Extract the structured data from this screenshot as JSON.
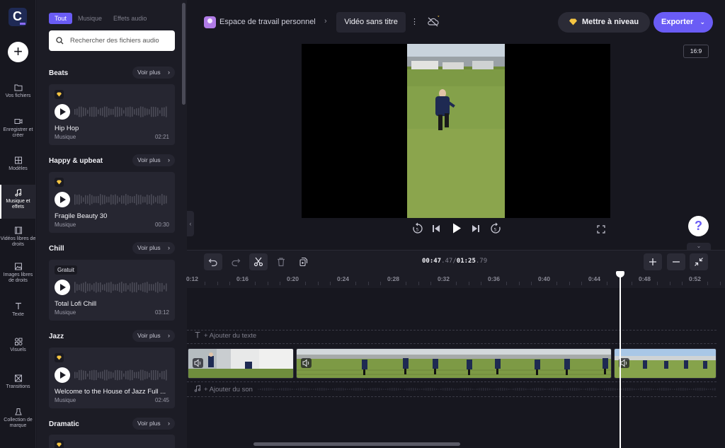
{
  "rail": {
    "items": [
      {
        "label": "Vos fichiers",
        "icon": "folder-icon"
      },
      {
        "label": "Enregistrer et créer",
        "icon": "camera-icon"
      },
      {
        "label": "Modèles",
        "icon": "templates-icon"
      },
      {
        "label": "Musique et effets",
        "icon": "music-note-icon",
        "active": true
      },
      {
        "label": "Vidéos libres de droits",
        "icon": "film-icon"
      },
      {
        "label": "Images libres de droits",
        "icon": "image-icon"
      },
      {
        "label": "Texte",
        "icon": "text-icon"
      },
      {
        "label": "Visuels",
        "icon": "shapes-icon"
      },
      {
        "label": "Transitions",
        "icon": "transition-icon"
      },
      {
        "label": "Collection de marque",
        "icon": "brand-icon"
      }
    ]
  },
  "library": {
    "tabs": [
      "Tout",
      "Musique",
      "Effets audio"
    ],
    "active_tab": "Tout",
    "search_placeholder": "Rechercher des fichiers audio",
    "see_more": "Voir plus",
    "sections": [
      {
        "title": "Beats",
        "track": {
          "name": "Hip Hop",
          "category": "Musique",
          "duration": "02:21",
          "badge": "premium"
        }
      },
      {
        "title": "Happy & upbeat",
        "track": {
          "name": "Fragile Beauty 30",
          "category": "Musique",
          "duration": "00:30",
          "badge": "premium"
        }
      },
      {
        "title": "Chill",
        "track": {
          "name": "Total Lofi Chill",
          "category": "Musique",
          "duration": "03:12",
          "badge": "Gratuit"
        }
      },
      {
        "title": "Jazz",
        "track": {
          "name": "Welcome to the House of Jazz Full ...",
          "category": "Musique",
          "duration": "02:45",
          "badge": "premium"
        }
      },
      {
        "title": "Dramatic",
        "track": {
          "name": "",
          "category": "",
          "duration": "",
          "badge": "premium"
        }
      }
    ]
  },
  "header": {
    "workspace": "Espace de travail personnel",
    "project_title": "Vidéo sans titre",
    "upgrade_label": "Mettre à niveau",
    "export_label": "Exporter"
  },
  "preview": {
    "aspect_ratio": "16:9"
  },
  "timeline": {
    "current_time": "00:47",
    "current_frames": ".47",
    "separator": "/",
    "total_time": "01:25",
    "total_frames": ".79",
    "ticks": [
      "0:12",
      "0:16",
      "0:20",
      "0:24",
      "0:28",
      "0:32",
      "0:36",
      "0:40",
      "0:44",
      "0:48",
      "0:52"
    ],
    "add_text": "+ Ajouter du texte",
    "add_sound": "+ Ajouter du son"
  },
  "colors": {
    "accent": "#6a5cf5",
    "background": "#17171f",
    "panel": "#1c1c25",
    "card": "#262631",
    "premium": "#f5c542"
  }
}
